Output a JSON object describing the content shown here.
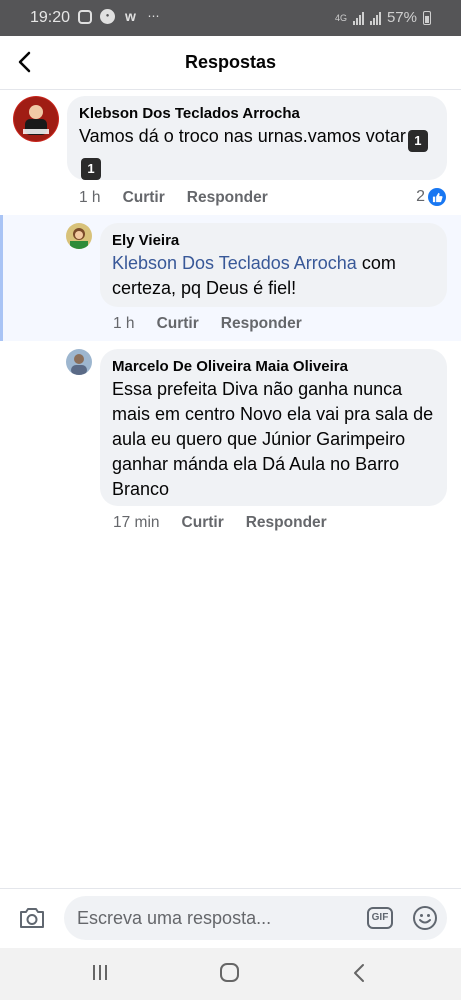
{
  "status_bar": {
    "time": "19:20",
    "battery": "57%",
    "network": "4G"
  },
  "header": {
    "title": "Respostas"
  },
  "comments": [
    {
      "author": "Klebson Dos Teclados Arrocha",
      "text": "Vamos dá o troco nas urnas.vamos votar",
      "emoji": [
        "1",
        "1"
      ],
      "time": "1 h",
      "like_label": "Curtir",
      "reply_label": "Responder",
      "reaction_count": "2"
    },
    {
      "author": "Ely Vieira",
      "mention": "Klebson Dos Teclados Arrocha",
      "text_after_mention": " com certeza, pq Deus é fiel!",
      "time": "1 h",
      "like_label": "Curtir",
      "reply_label": "Responder"
    },
    {
      "author": "Marcelo De Oliveira Maia Oliveira",
      "text": "Essa prefeita Diva não ganha nunca mais em centro Novo ela vai pra sala de aula eu quero que Júnior Garimpeiro ganhar mánda ela Dá Aula no Barro Branco",
      "time": "17 min",
      "like_label": "Curtir",
      "reply_label": "Responder"
    }
  ],
  "composer": {
    "placeholder": "Escreva uma resposta...",
    "gif_label": "GIF"
  },
  "icons": [
    "back-arrow-icon",
    "camera-icon",
    "gif-icon",
    "smiley-icon",
    "like-icon",
    "recent-apps-icon",
    "home-icon",
    "nav-back-icon"
  ],
  "colors": {
    "like_blue": "#1877f2",
    "mention": "#385898",
    "bubble": "#f0f2f5"
  }
}
